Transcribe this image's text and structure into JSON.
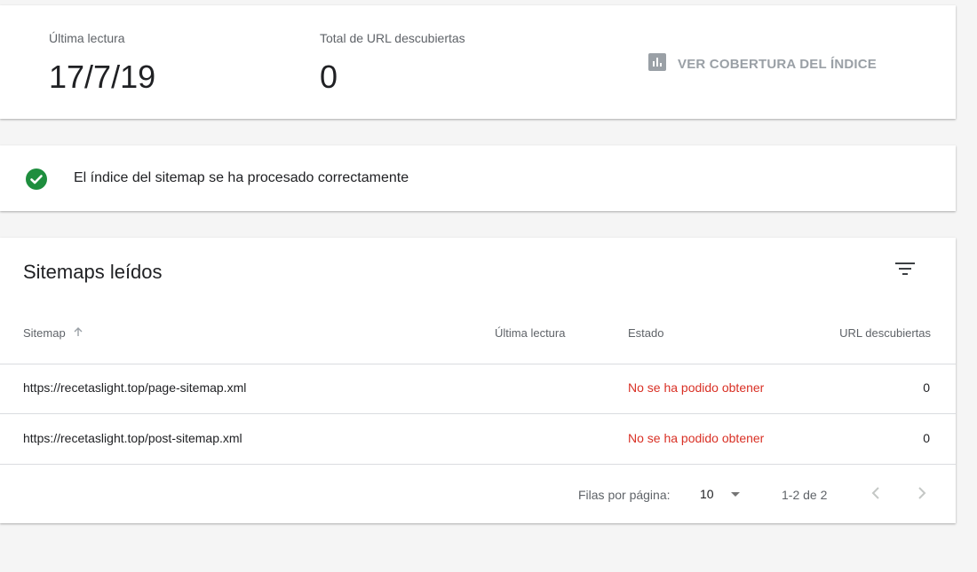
{
  "summary": {
    "last_read_label": "Última lectura",
    "last_read_value": "17/7/19",
    "total_urls_label": "Total de URL descubiertas",
    "total_urls_value": "0",
    "coverage_link_label": "VER COBERTURA DEL ÍNDICE",
    "coverage_icon": "bar-chart-icon"
  },
  "status": {
    "icon": "check-circle-icon",
    "icon_color": "#1e8e3e",
    "message": "El índice del sitemap se ha procesado correctamente"
  },
  "table": {
    "title": "Sitemaps leídos",
    "filter_icon": "filter-icon",
    "columns": {
      "sitemap": "Sitemap",
      "last_read": "Última lectura",
      "state": "Estado",
      "urls": "URL descubiertas"
    },
    "sort_icon": "arrow-up-icon",
    "rows": [
      {
        "sitemap": "https://recetaslight.top/page-sitemap.xml",
        "last_read": "",
        "state": "No se ha podido obtener",
        "urls": "0"
      },
      {
        "sitemap": "https://recetaslight.top/post-sitemap.xml",
        "last_read": "",
        "state": "No se ha podido obtener",
        "urls": "0"
      }
    ],
    "error_color": "#d93025",
    "pagination": {
      "rows_per_page_label": "Filas por página:",
      "rows_per_page_value": "10",
      "range": "1-2 de 2"
    }
  }
}
